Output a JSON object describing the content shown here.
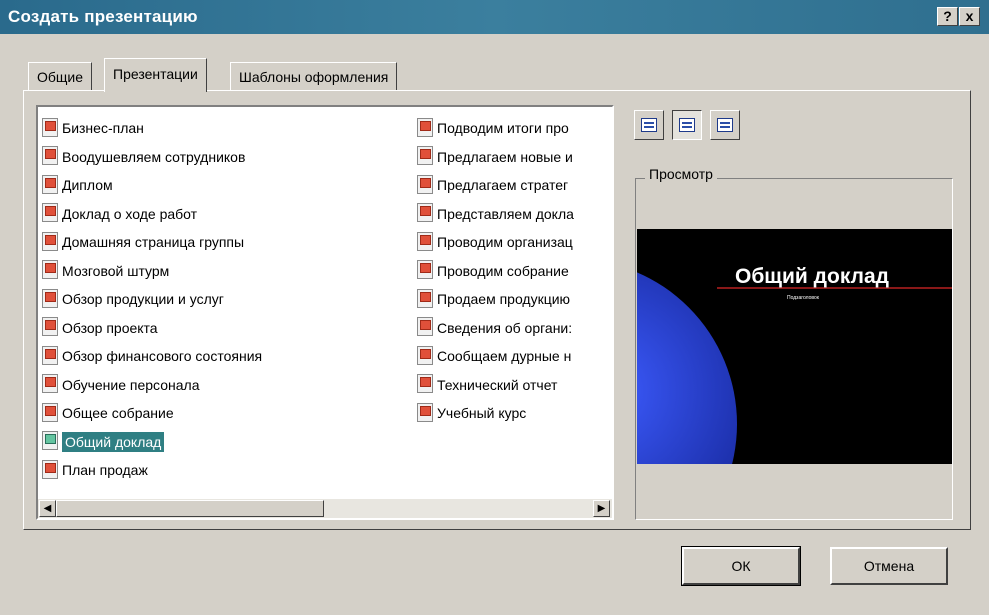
{
  "window": {
    "title": "Создать презентацию",
    "help_button": "?",
    "close_button": "x"
  },
  "tabs": [
    {
      "label": "Общие",
      "active": false
    },
    {
      "label": "Презентации",
      "active": true
    },
    {
      "label": "Шаблоны оформления",
      "active": false
    }
  ],
  "list": {
    "column1": [
      "Бизнес-план",
      "Воодушевляем сотрудников",
      "Диплом",
      "Доклад о ходе работ",
      "Домашняя страница группы",
      "Мозговой штурм",
      "Обзор продукции и услуг",
      "Обзор проекта",
      "Обзор финансового состояния",
      "Обучение персонала",
      "Общее собрание",
      "Общий доклад",
      "План продаж"
    ],
    "column2": [
      "Подводим итоги про",
      "Предлагаем новые и",
      "Предлагаем стратег",
      "Представляем докла",
      "Проводим организац",
      "Проводим собрание",
      "Продаем продукцию",
      "Сведения об органи:",
      "Сообщаем дурные н",
      "Технический отчет",
      "Учебный курс"
    ],
    "selected": "Общий доклад"
  },
  "view_buttons": [
    "large-icons-icon",
    "list-icon",
    "details-icon"
  ],
  "preview": {
    "legend": "Просмотр",
    "slide_title": "Общий доклад",
    "slide_subtitle": "Подзаголовок"
  },
  "buttons": {
    "ok": "ОК",
    "cancel": "Отмена"
  },
  "colors": {
    "titlebar": "#2f6f8f",
    "selection": "#2f7f83",
    "slide_background": "#000000",
    "slide_accent": "#1b2ea8"
  }
}
